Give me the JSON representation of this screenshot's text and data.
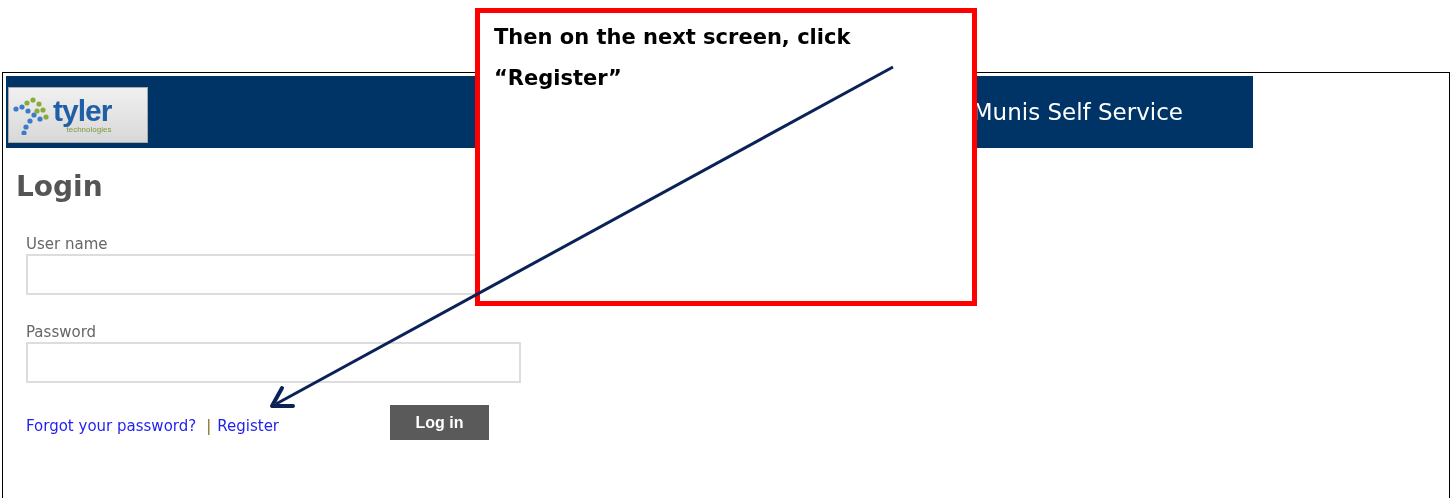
{
  "header": {
    "logo": {
      "name": "tyler",
      "subtitle": "technologies"
    },
    "title": "Munis Self Service"
  },
  "login": {
    "heading": "Login",
    "fields": [
      {
        "label": "User name"
      },
      {
        "label": "Password"
      }
    ],
    "links": [
      {
        "label": "Forgot your password?"
      },
      {
        "label": "Register"
      }
    ],
    "separator": "|",
    "button": "Log in"
  },
  "callout": {
    "text": "Then on the next screen, click “Register”"
  }
}
